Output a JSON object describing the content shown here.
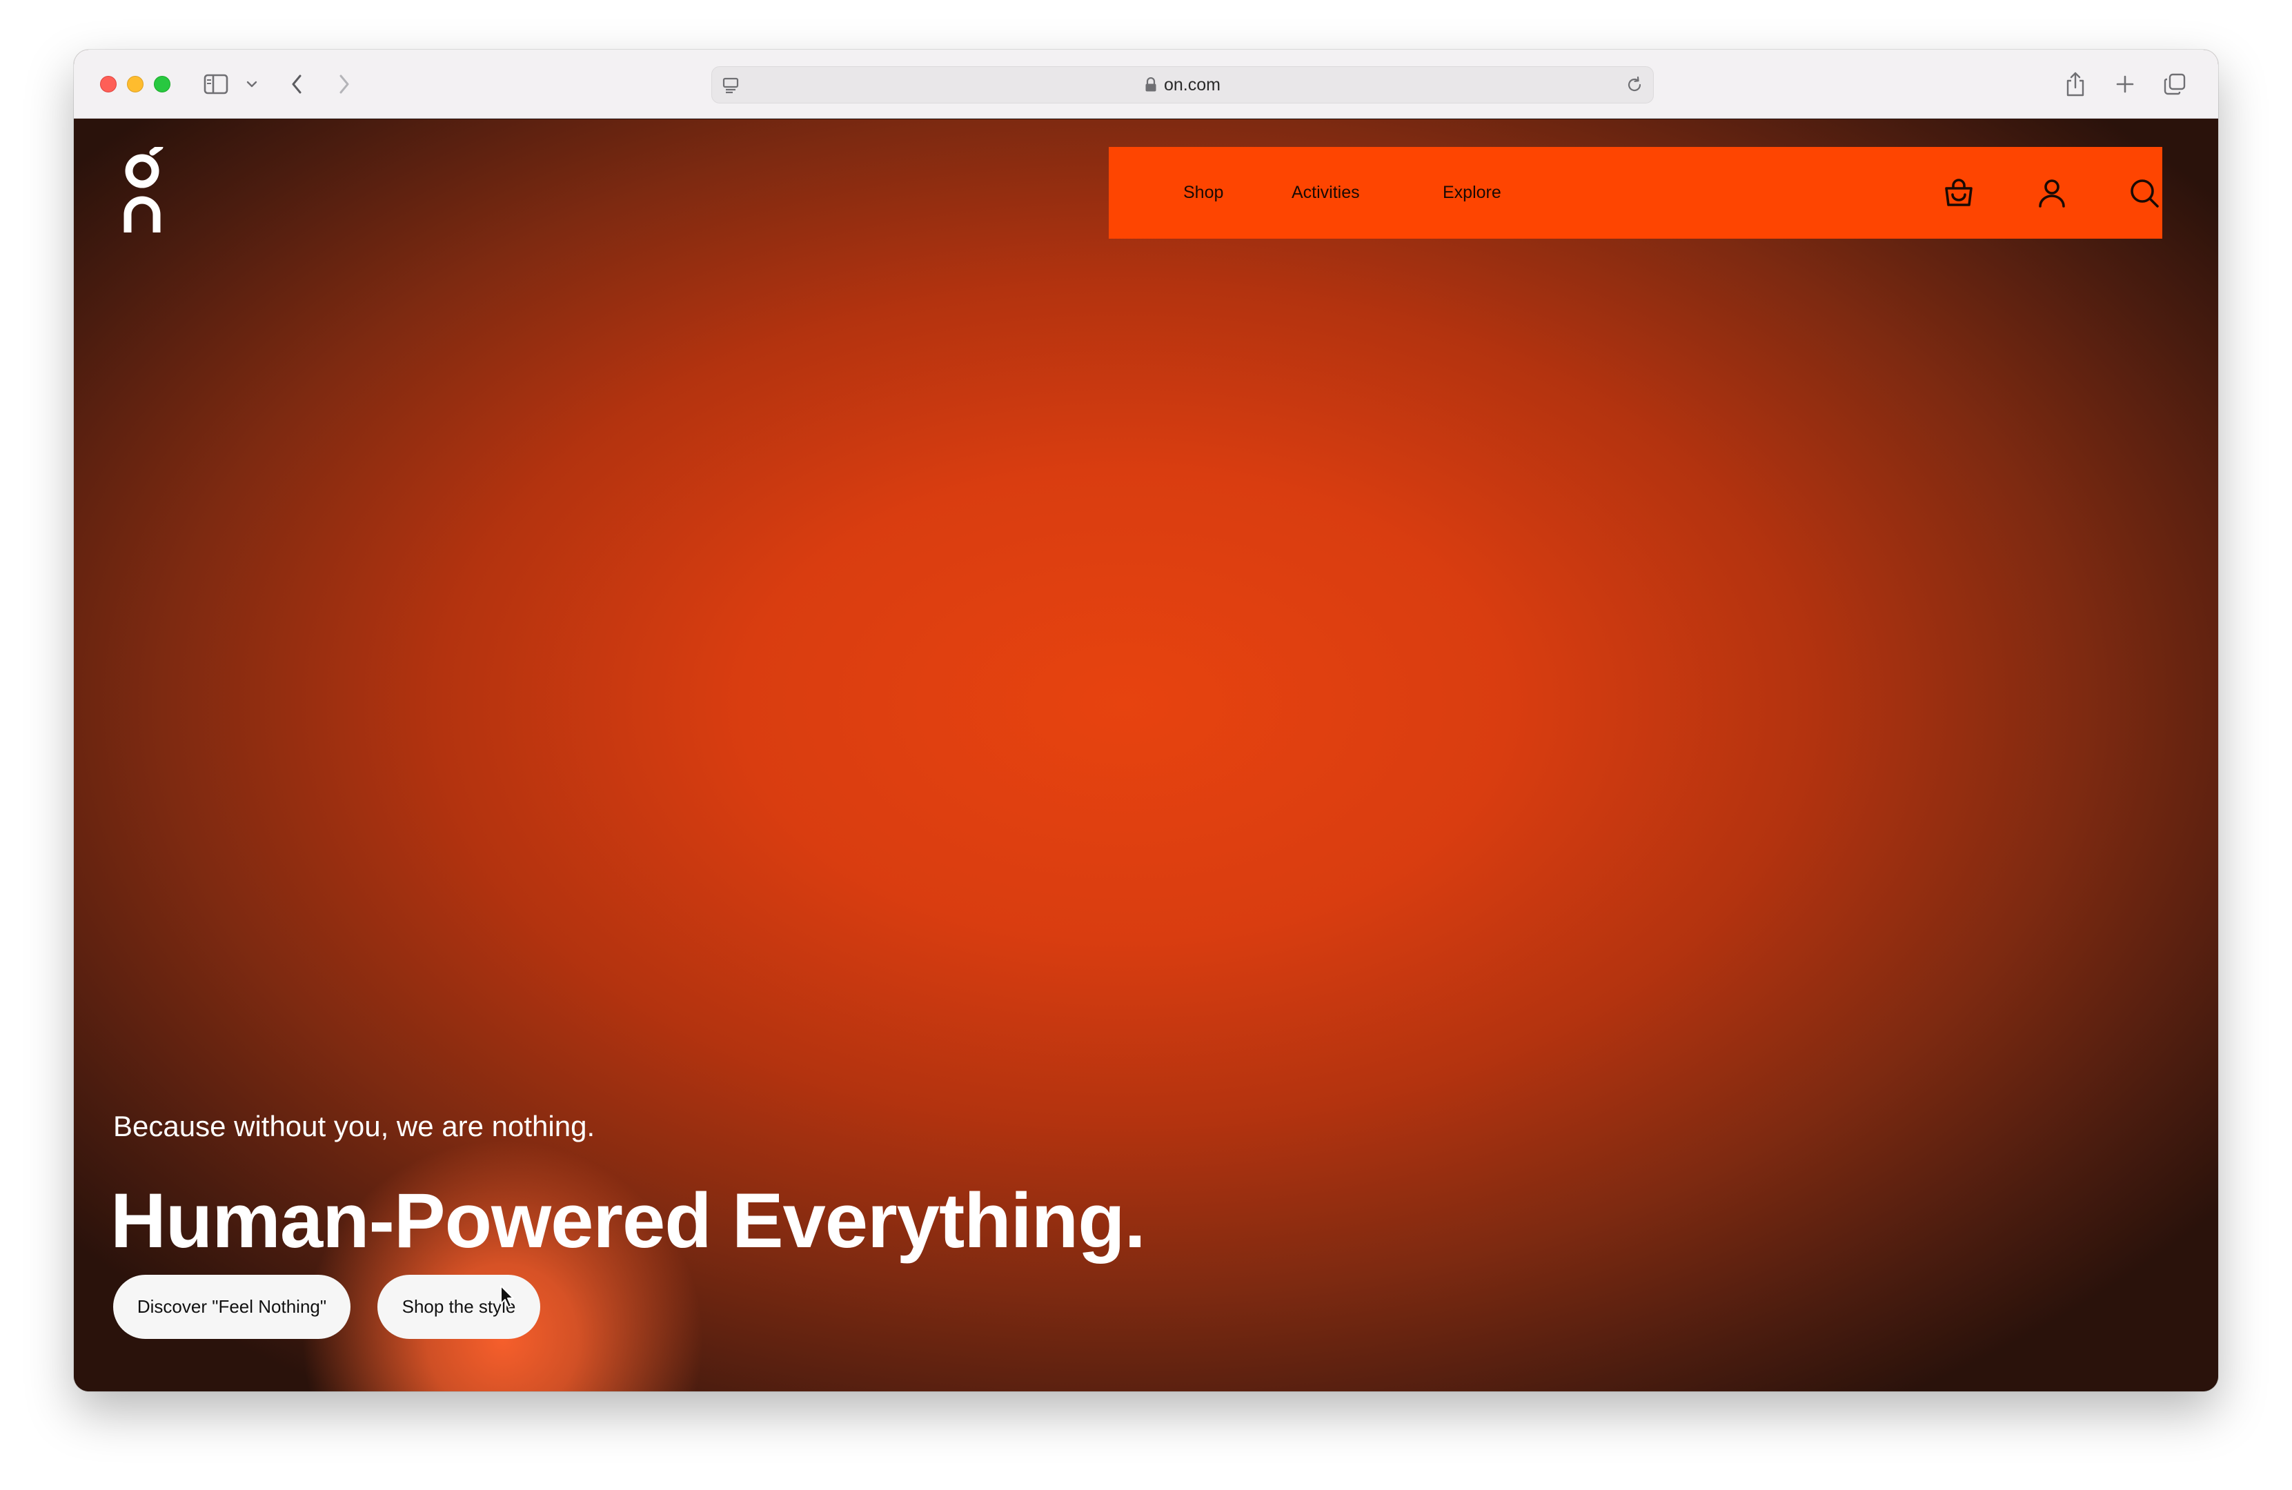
{
  "browser": {
    "url": "on.com",
    "icons": {
      "sidebar": "sidebar-icon",
      "back": "chevron-left-icon",
      "forward": "chevron-right-icon",
      "share": "share-icon",
      "new_tab": "plus-icon",
      "tabs": "tabs-overview-icon",
      "reload": "reload-icon",
      "lock": "lock-icon"
    }
  },
  "site": {
    "logo_icon": "on-logo-icon",
    "nav": {
      "links": [
        "Shop",
        "Activities",
        "Explore"
      ],
      "icons": [
        "cart-icon",
        "account-icon",
        "search-icon"
      ]
    },
    "hero": {
      "subtitle": "Because without you, we are nothing.",
      "headline": "Human-Powered Everything.",
      "buttons": [
        "Discover \"Feel Nothing\"",
        "Shop the style"
      ]
    }
  },
  "colors": {
    "accent": "#fe4501",
    "hero_center": "#e7430f",
    "hero_edge": "#2a120b"
  }
}
